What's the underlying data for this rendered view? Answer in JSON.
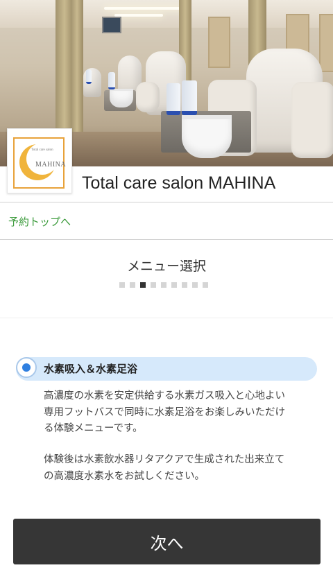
{
  "salon": {
    "name": "Total care salon MAHINA",
    "logo_text": "MAHINA",
    "logo_small_text": "Total care salon"
  },
  "nav": {
    "top_link": "予約トップへ"
  },
  "step": {
    "title": "メニュー選択",
    "total_steps": 9,
    "current_step": 3
  },
  "menu": {
    "selected_option": {
      "label": "水素吸入＆水素足浴",
      "checked": true,
      "description_lines": [
        "高濃度の水素を安定供給する水素ガス吸入と心地よい",
        "専用フットバスで同時に水素足浴をお楽しみいただけ",
        "る体験メニューです。",
        "体験後は水素飲水器リタアクアで生成された出来立て",
        "の高濃度水素水をお試しください。"
      ]
    }
  },
  "actions": {
    "next_label": "次へ"
  },
  "colors": {
    "link_green": "#3a9a3a",
    "radio_blue": "#2f7fe0",
    "option_highlight": "#d6e9fb",
    "button_dark": "#363636",
    "logo_orange": "#e8a23a"
  }
}
